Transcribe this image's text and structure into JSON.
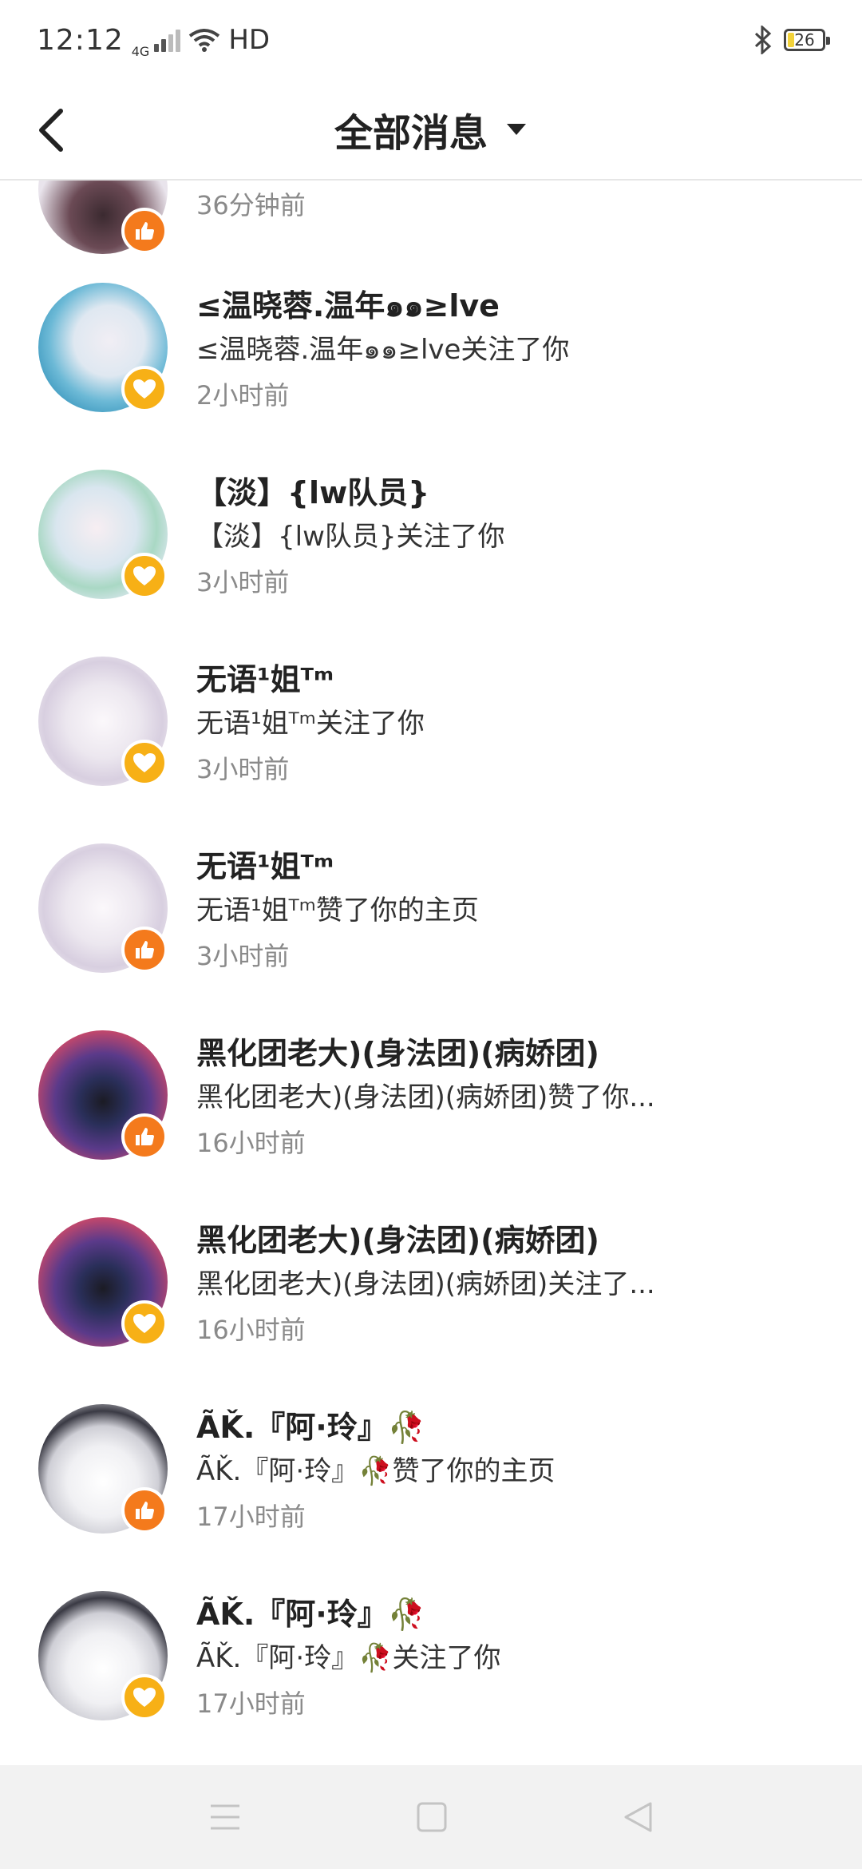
{
  "status_bar": {
    "time": "12:12",
    "network": "4G",
    "hd": "HD",
    "battery": "26"
  },
  "header": {
    "title": "全部消息"
  },
  "colors": {
    "like_badge": "#f47a1c",
    "follow_badge": "#f7b016",
    "time_text": "#8a8a8a"
  },
  "notifications": [
    {
      "time": "36分钟前",
      "type": "like"
    },
    {
      "name": "≤温晓蓉.温年๑๑≥lve",
      "message": "≤温晓蓉.温年๑๑≥lve关注了你",
      "time": "2小时前",
      "type": "follow"
    },
    {
      "name": "【淡】{lw队员}",
      "message": "【淡】{lw队员}关注了你",
      "time": "3小时前",
      "type": "follow"
    },
    {
      "name": "无语¹姐ᵀᵐ",
      "message": "无语¹姐ᵀᵐ关注了你",
      "time": "3小时前",
      "type": "follow"
    },
    {
      "name": "无语¹姐ᵀᵐ",
      "message": "无语¹姐ᵀᵐ赞了你的主页",
      "time": "3小时前",
      "type": "like"
    },
    {
      "name": "黑化团老大)(身法团)(病娇团)",
      "message": "黑化团老大)(身法团)(病娇团)赞了你...",
      "time": "16小时前",
      "type": "like"
    },
    {
      "name": "黑化团老大)(身法团)(病娇团)",
      "message": "黑化团老大)(身法团)(病娇团)关注了...",
      "time": "16小时前",
      "type": "follow"
    },
    {
      "name": "ÃǨ.『阿·玲』🥀",
      "message": "ÃǨ.『阿·玲』🥀赞了你的主页",
      "time": "17小时前",
      "type": "like"
    },
    {
      "name": "ÃǨ.『阿·玲』🥀",
      "message": "ÃǨ.『阿·玲』🥀关注了你",
      "time": "17小时前",
      "type": "follow"
    }
  ],
  "icons": {
    "back": "chevron-left-icon",
    "dropdown": "caret-down-icon",
    "like": "thumbs-up-icon",
    "follow": "heart-icon",
    "nav_menu": "menu-icon",
    "nav_home": "square-icon",
    "nav_back": "triangle-back-icon"
  }
}
